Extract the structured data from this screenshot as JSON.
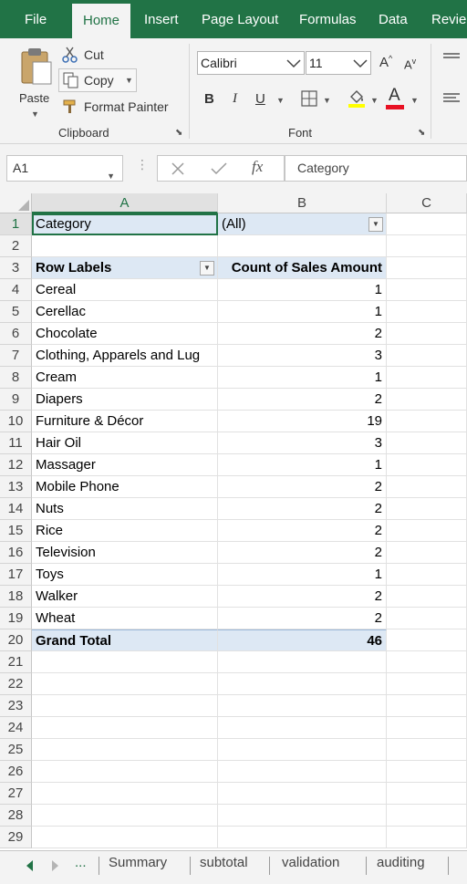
{
  "ribbon_tabs": [
    "File",
    "Home",
    "Insert",
    "Page Layout",
    "Formulas",
    "Data",
    "Revie"
  ],
  "active_tab": "Home",
  "clipboard": {
    "paste": "Paste",
    "cut": "Cut",
    "copy": "Copy",
    "format_painter": "Format Painter",
    "group": "Clipboard"
  },
  "font": {
    "name": "Calibri",
    "size": "11",
    "bold": "B",
    "italic": "I",
    "underline": "U",
    "font_color_glyph": "A",
    "grow_glyph": "A",
    "shrink_glyph": "A",
    "group": "Font",
    "font_color": "#e81123"
  },
  "formula_bar": {
    "name_box": "A1",
    "fx": "fx",
    "content": "Category"
  },
  "columns": [
    "A",
    "B",
    "C"
  ],
  "row_numbers": [
    "1",
    "2",
    "3",
    "4",
    "5",
    "6",
    "7",
    "8",
    "9",
    "10",
    "11",
    "12",
    "13",
    "14",
    "15",
    "16",
    "17",
    "18",
    "19",
    "20",
    "21",
    "22",
    "23",
    "24",
    "25",
    "26",
    "27",
    "28",
    "29"
  ],
  "pivot": {
    "filter_label": "Category",
    "filter_value": "(All)",
    "row_labels_header": "Row Labels",
    "value_header": "Count of Sales Amount",
    "rows": [
      {
        "label": "Cereal",
        "value": "1"
      },
      {
        "label": "Cerellac",
        "value": "1"
      },
      {
        "label": "Chocolate",
        "value": "2"
      },
      {
        "label": "Clothing, Apparels and Lug",
        "value": "3"
      },
      {
        "label": "Cream",
        "value": "1"
      },
      {
        "label": "Diapers",
        "value": "2"
      },
      {
        "label": "Furniture & Décor",
        "value": "19"
      },
      {
        "label": "Hair Oil",
        "value": "3"
      },
      {
        "label": "Massager",
        "value": "1"
      },
      {
        "label": "Mobile Phone",
        "value": "2"
      },
      {
        "label": "Nuts",
        "value": "2"
      },
      {
        "label": "Rice",
        "value": "2"
      },
      {
        "label": "Television",
        "value": "2"
      },
      {
        "label": "Toys",
        "value": "1"
      },
      {
        "label": "Walker",
        "value": "2"
      },
      {
        "label": "Wheat",
        "value": "2"
      }
    ],
    "grand_total_label": "Grand Total",
    "grand_total_value": "46"
  },
  "sheet_tabs": [
    "Summary",
    "subtotal",
    "validation",
    "auditing"
  ],
  "sheet_nav_ellipsis": "...",
  "colors": {
    "excel_green": "#217346",
    "pivot_band": "#dde8f4"
  }
}
